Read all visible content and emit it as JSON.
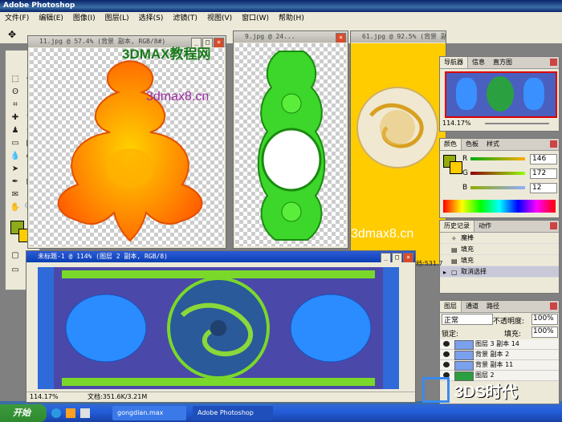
{
  "app": {
    "title": "Adobe Photoshop"
  },
  "menu": [
    "文件(F)",
    "编辑(E)",
    "图像(I)",
    "图层(L)",
    "选择(S)",
    "滤镜(T)",
    "视图(V)",
    "窗口(W)",
    "帮助(H)"
  ],
  "docs": {
    "doc1": {
      "title": "11.jpg @ 57.4% (背景 副本, RGB/8#)"
    },
    "doc2": {
      "title": "9.jpg @ 24..."
    },
    "doc3": {
      "title": "61.jpg @ 92.5% (背景 副本, RGB/8#)"
    },
    "doc4": {
      "title": "未标题-1 @ 114% (图层 2 副本, RGB/8)",
      "zoom": "114.17%",
      "docsize": "文档:351.6K/3.21M",
      "partial": "档:531.7"
    }
  },
  "watermarks": {
    "big": "3DMAX教程网",
    "url1": "3dmax8.cn",
    "url2": "3dmax8.cn"
  },
  "navigator": {
    "tabs": [
      "导航器",
      "信息",
      "直方图"
    ],
    "zoom": "114.17%"
  },
  "color": {
    "tabs": [
      "颜色",
      "色板",
      "样式"
    ],
    "r_label": "R",
    "g_label": "G",
    "b_label": "B",
    "r": "146",
    "g": "172",
    "b": "12",
    "fg_color": "#92ac0c"
  },
  "history": {
    "tabs": [
      "历史记录",
      "动作"
    ],
    "items": [
      "魔棒",
      "填充",
      "填充",
      "取消选择"
    ]
  },
  "layers": {
    "tabs": [
      "图层",
      "通道",
      "路径"
    ],
    "blend": "正常",
    "opacity_label": "不透明度:",
    "opacity": "100%",
    "lock_label": "锁定:",
    "fill_label": "填充:",
    "fill": "100%",
    "items": [
      "图层 3 副本 14",
      "背景 副本 2",
      "背景 副本 11",
      "图层 2"
    ]
  },
  "taskbar": {
    "start": "开始",
    "tasks": [
      "gongdian.max",
      "Adobe Photoshop"
    ]
  },
  "logo": {
    "text": "3DS时代"
  }
}
